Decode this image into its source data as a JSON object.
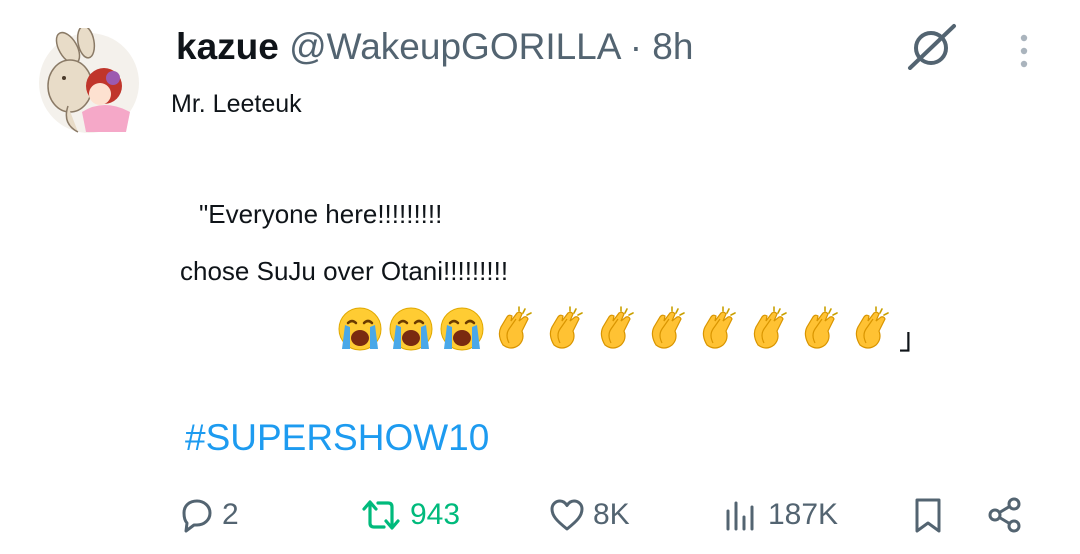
{
  "tweet": {
    "display_name": "kazue",
    "handle": "@WakeupGORILLA",
    "separator": "·",
    "time": "8h",
    "subtitle": "Mr. Leeteuk",
    "lines": [
      "\"Everyone here!!!!!!!!!",
      "chose SuJu over Otani!!!!!!!!!"
    ],
    "emoji_row": {
      "crying": 3,
      "clapping": 8,
      "closing_bracket": "」"
    },
    "hashtag": "#SUPERSHOW10"
  },
  "actions": {
    "replies": "2",
    "reposts": "943",
    "likes": "8K",
    "views": "187K"
  },
  "colors": {
    "link": "#1d9bf0",
    "repost": "#00ba7c",
    "muted": "#536471",
    "text": "#0f1419"
  },
  "icons": [
    "grok-icon",
    "more-icon",
    "reply-icon",
    "repost-icon",
    "like-icon",
    "views-icon",
    "bookmark-icon",
    "share-icon"
  ]
}
